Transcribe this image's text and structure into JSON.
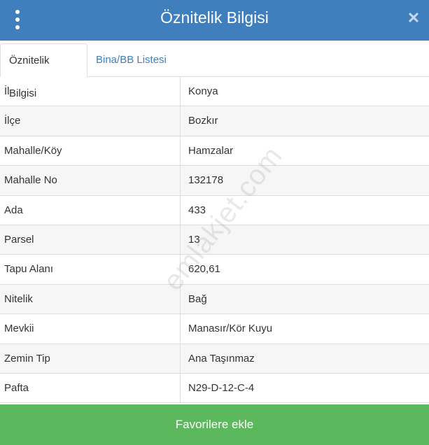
{
  "header": {
    "title": "Öznitelik Bilgisi",
    "menu_icon": "vertical-dots-icon",
    "close_icon": "close-icon",
    "close_glyph": "✕"
  },
  "tabs": [
    {
      "label": "Öznitelik Bilgisi",
      "active": true
    },
    {
      "label": "Bina/BB Listesi",
      "active": false
    }
  ],
  "attributes": [
    {
      "key": "İl",
      "value": "Konya"
    },
    {
      "key": "İlçe",
      "value": "Bozkır"
    },
    {
      "key": "Mahalle/Köy",
      "value": "Hamzalar"
    },
    {
      "key": "Mahalle No",
      "value": "132178"
    },
    {
      "key": "Ada",
      "value": "433"
    },
    {
      "key": "Parsel",
      "value": "13"
    },
    {
      "key": "Tapu Alanı",
      "value": "620,61"
    },
    {
      "key": "Nitelik",
      "value": "Bağ"
    },
    {
      "key": "Mevkii",
      "value": "Manasır/Kör Kuyu"
    },
    {
      "key": "Zemin Tip",
      "value": "Ana Taşınmaz"
    },
    {
      "key": "Pafta",
      "value": "N29-D-12-C-4"
    }
  ],
  "watermark": "emlakjet.com",
  "actions": {
    "favorite_label": "Favorilere ekle"
  },
  "colors": {
    "header": "#3f7fbe",
    "button": "#5cb85c",
    "tab_link": "#3f7fbe"
  }
}
